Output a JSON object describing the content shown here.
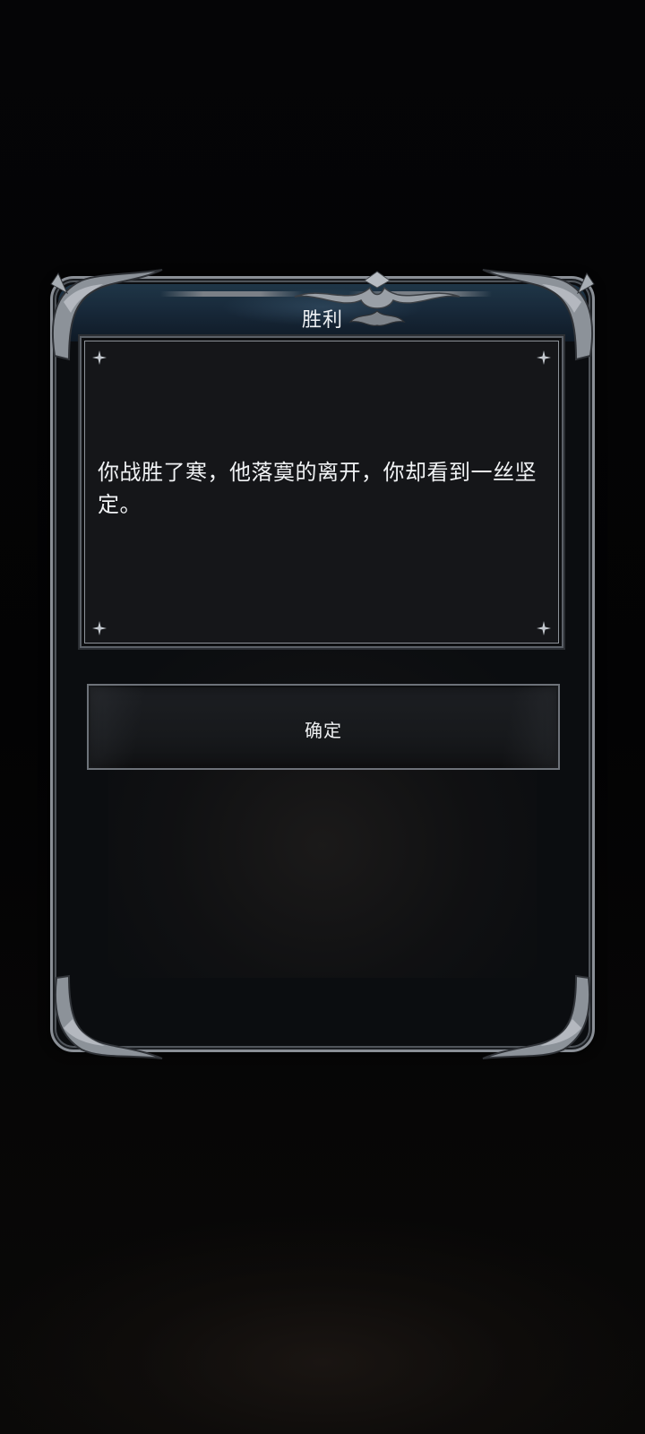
{
  "dialog": {
    "title": "胜利",
    "message": "你战胜了寒，他落寞的离开，你却看到一丝坚定。",
    "confirm_label": "确定"
  },
  "icons": {
    "corner_ornament": "ornate-silver-corner-icon",
    "title_crest": "silver-crest-icon",
    "sparkle": "four-point-star-icon"
  },
  "colors": {
    "background": "#030304",
    "frame_silver": "#8a8f96",
    "title_bar": "#1f3647",
    "panel": "#151619",
    "text": "#f1f3f5"
  }
}
